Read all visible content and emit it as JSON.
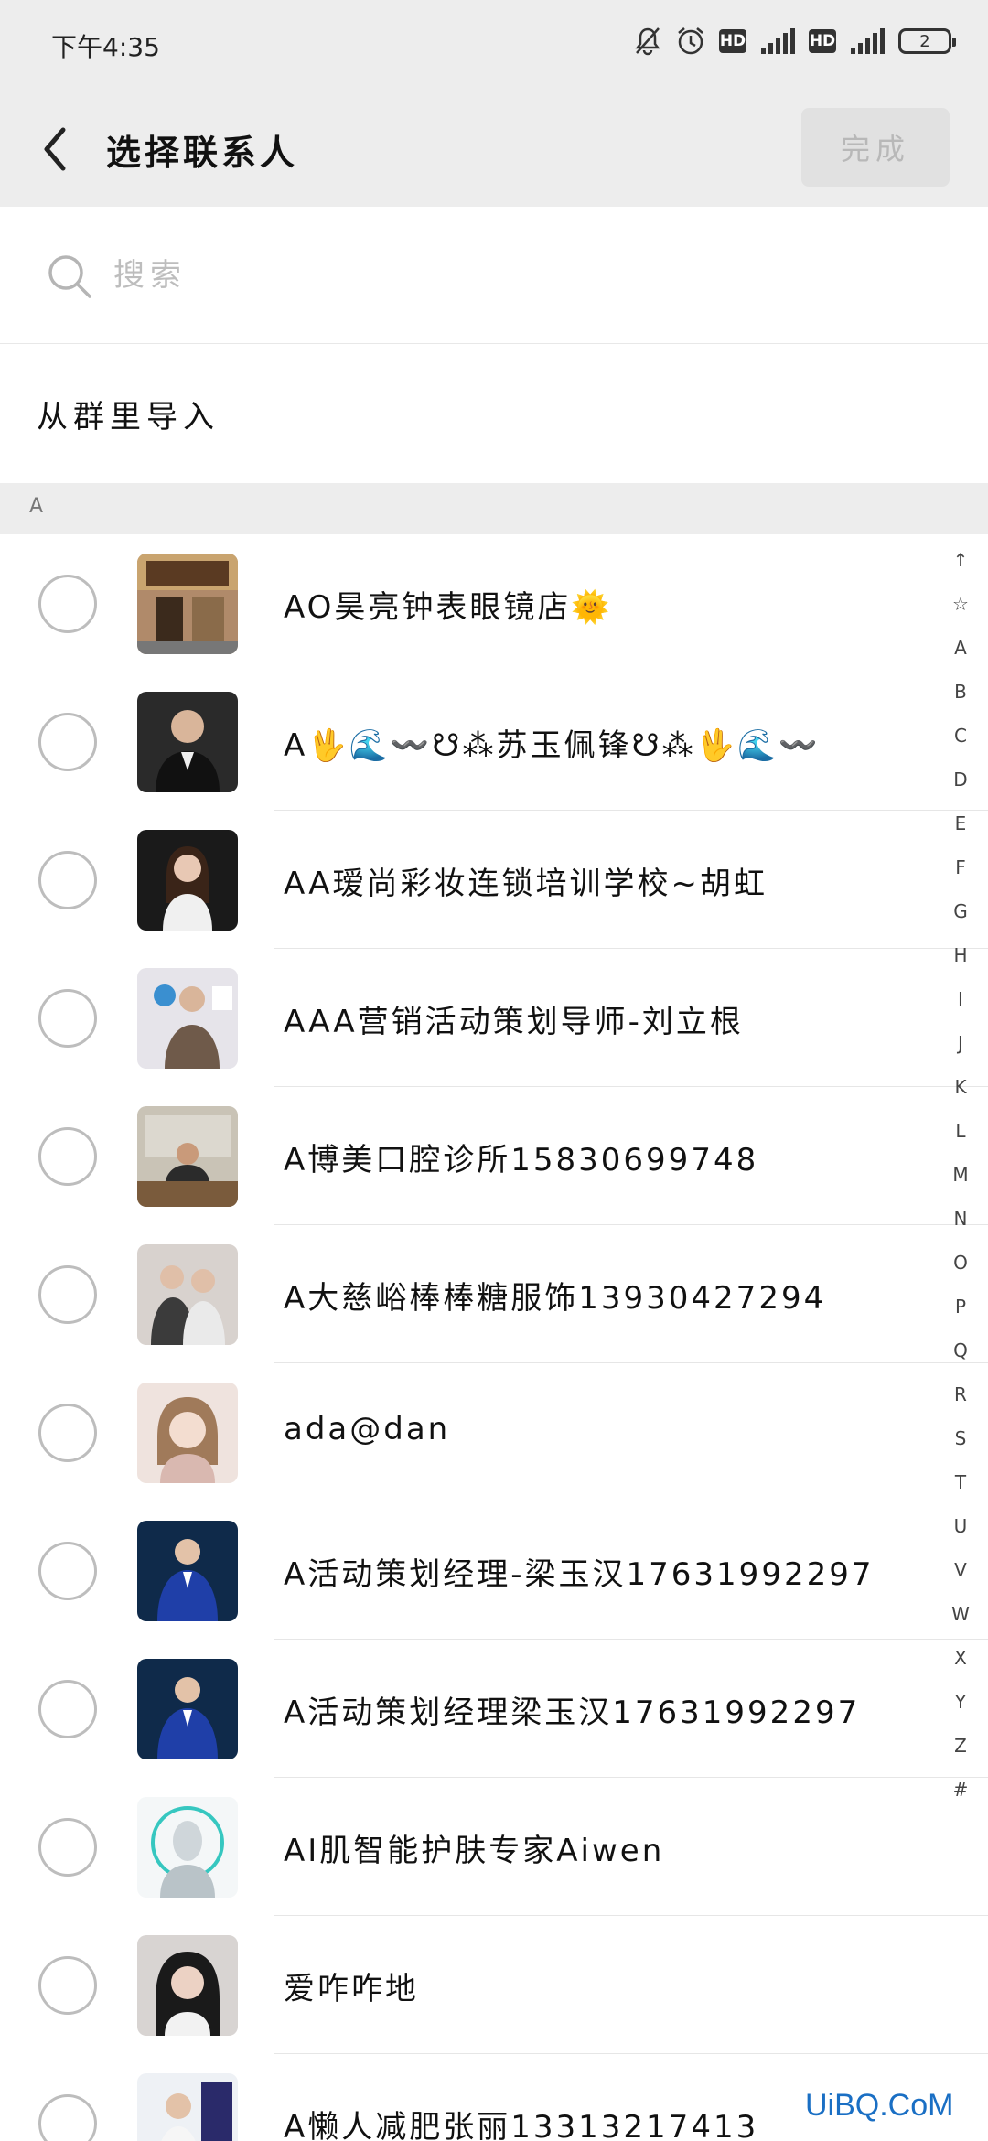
{
  "status_bar": {
    "time": "下午4:35",
    "hd_badge_1": "HD",
    "hd_badge_2": "HD",
    "battery": "2"
  },
  "header": {
    "title": "选择联系人",
    "done_label": "完成"
  },
  "search": {
    "placeholder": "搜索"
  },
  "import_from_group": "从群里导入",
  "section": "A",
  "contacts": [
    {
      "name": "AO昊亮钟表眼镜店🌞"
    },
    {
      "name": "A🖖🌊〰️☋⁂苏玉佩锋☋⁂🖖🌊〰️"
    },
    {
      "name": "AA瑷尚彩妆连锁培训学校~胡虹"
    },
    {
      "name": "AAA营销活动策划导师-刘立根"
    },
    {
      "name": "A博美口腔诊所15830699748"
    },
    {
      "name": "A大慈峪棒棒糖服饰13930427294"
    },
    {
      "name": "ada@dan"
    },
    {
      "name": "A活动策划经理-梁玉汉17631992297"
    },
    {
      "name": "A活动策划经理梁玉汉17631992297"
    },
    {
      "name": "AI肌智能护肤专家Aiwen"
    },
    {
      "name": "爱咋咋地"
    },
    {
      "name": "A懒人减肥张丽13313217413"
    }
  ],
  "index_bar": [
    "↑",
    "☆",
    "A",
    "B",
    "C",
    "D",
    "E",
    "F",
    "G",
    "H",
    "I",
    "J",
    "K",
    "L",
    "M",
    "N",
    "O",
    "P",
    "Q",
    "R",
    "S",
    "T",
    "U",
    "V",
    "W",
    "X",
    "Y",
    "Z",
    "#"
  ],
  "watermark": "UiBQ.CoM",
  "colors": {
    "header_bg": "#ededed",
    "done_disabled_bg": "#e1e1e1",
    "done_disabled_text": "#b8b8b8",
    "radio_border": "#bdbdbd",
    "watermark": "#1a6fc4"
  }
}
